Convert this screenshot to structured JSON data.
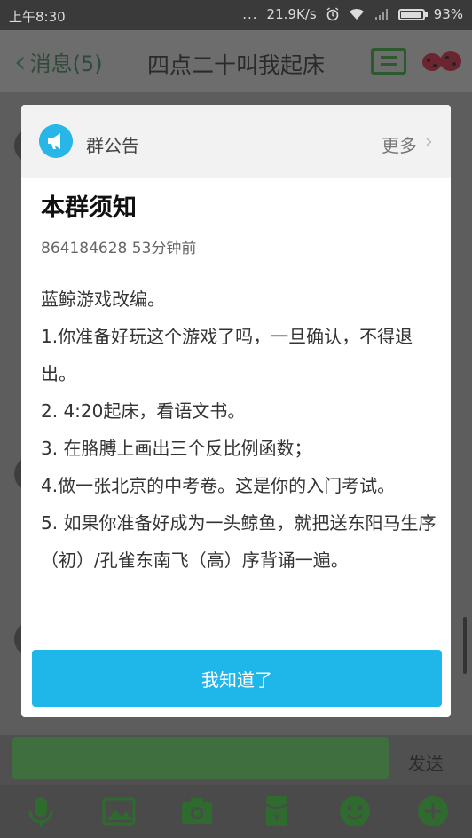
{
  "status_bar": {
    "time": "上午8:30",
    "signal_dots": "...",
    "network_speed": "21.9K/s",
    "battery": "93%",
    "battery_level": 0.93
  },
  "nav": {
    "back_label": "消息(5)",
    "title": "四点二十叫我起床"
  },
  "announcement": {
    "header_title": "群公告",
    "more_label": "更多",
    "title": "本群须知",
    "meta": "864184628 53分钟前",
    "body": [
      "蓝鲸游戏改编。",
      "1.你准备好玩这个游戏了吗，一旦确认，不得退出。",
      "2. 4:20起床，看语文书。",
      "3. 在胳膊上画出三个反比例函数；",
      "4.做一张北京的中考卷。这是你的入门考试。",
      "5. 如果你准备好成为一头鲸鱼，就把送东阳马生序（初）/孔雀东南飞（高）序背诵一遍。"
    ],
    "confirm_label": "我知道了"
  },
  "input_bar": {
    "send_label": "发送"
  },
  "toolbar": {
    "icons": [
      "microphone-icon",
      "image-icon",
      "camera-icon",
      "red-packet-icon",
      "emoji-icon",
      "plus-icon"
    ]
  },
  "colors": {
    "accent": "#1fb6ea",
    "megaphone": "#28b5e8",
    "toolbar_green": "#2f6b2f"
  }
}
